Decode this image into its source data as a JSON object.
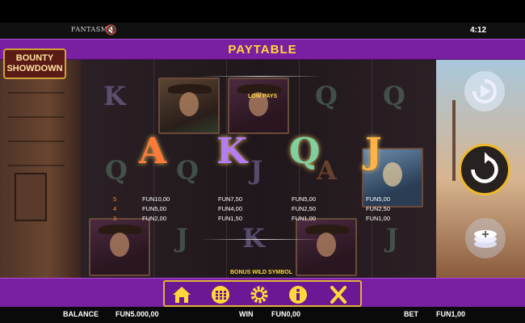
{
  "topbar": {
    "brand": "FANTASMA",
    "clock": "4:12",
    "mute_icon": "speaker-muted-icon"
  },
  "header": {
    "title": "PAYTABLE"
  },
  "logo": {
    "line1": "BOUNTY",
    "line2": "SHOWDOWN"
  },
  "paytable": {
    "low_pays_label": "LOW PAYS",
    "bonus_label": "BONUS WILD SYMBOL",
    "groups": [
      {
        "symbols": "A",
        "rows": [
          {
            "count": "5",
            "pay": "FUN10,00"
          },
          {
            "count": "4",
            "pay": "FUN5,00"
          },
          {
            "count": "3",
            "pay": "FUN2,00"
          }
        ]
      },
      {
        "symbols": "K",
        "rows": [
          {
            "count": "",
            "pay": "FUN7,50"
          },
          {
            "count": "",
            "pay": "FUN4,00"
          },
          {
            "count": "",
            "pay": "FUN1,50"
          }
        ]
      },
      {
        "symbols": "Q",
        "rows": [
          {
            "count": "",
            "pay": "FUN5,00"
          },
          {
            "count": "",
            "pay": "FUN2,50"
          },
          {
            "count": "",
            "pay": "FUN1,00"
          }
        ]
      },
      {
        "symbols": "J",
        "rows": [
          {
            "count": "",
            "pay": "FUN5,00"
          },
          {
            "count": "",
            "pay": "FUN2,50"
          },
          {
            "count": "",
            "pay": "FUN1,00"
          }
        ]
      }
    ]
  },
  "symbols": {
    "a": "A",
    "k": "K",
    "q": "Q",
    "j": "J"
  },
  "bg_letters": {
    "k": "K",
    "q": "Q",
    "j": "J",
    "a": "A"
  },
  "controls": [
    "autoplay-icon",
    "spin-icon",
    "stake-icon"
  ],
  "menu": [
    "home-icon",
    "paytable-icon",
    "settings-icon",
    "info-icon",
    "close-icon"
  ],
  "status": {
    "balance_label": "BALANCE",
    "balance_value": "FUN5.000,00",
    "win_label": "WIN",
    "win_value": "FUN0,00",
    "bet_label": "BET",
    "bet_value": "FUN1,00"
  },
  "colors": {
    "accent_purple": "#7a1fa2",
    "title_yellow": "#ffd83a",
    "gold": "#e0b13a"
  }
}
